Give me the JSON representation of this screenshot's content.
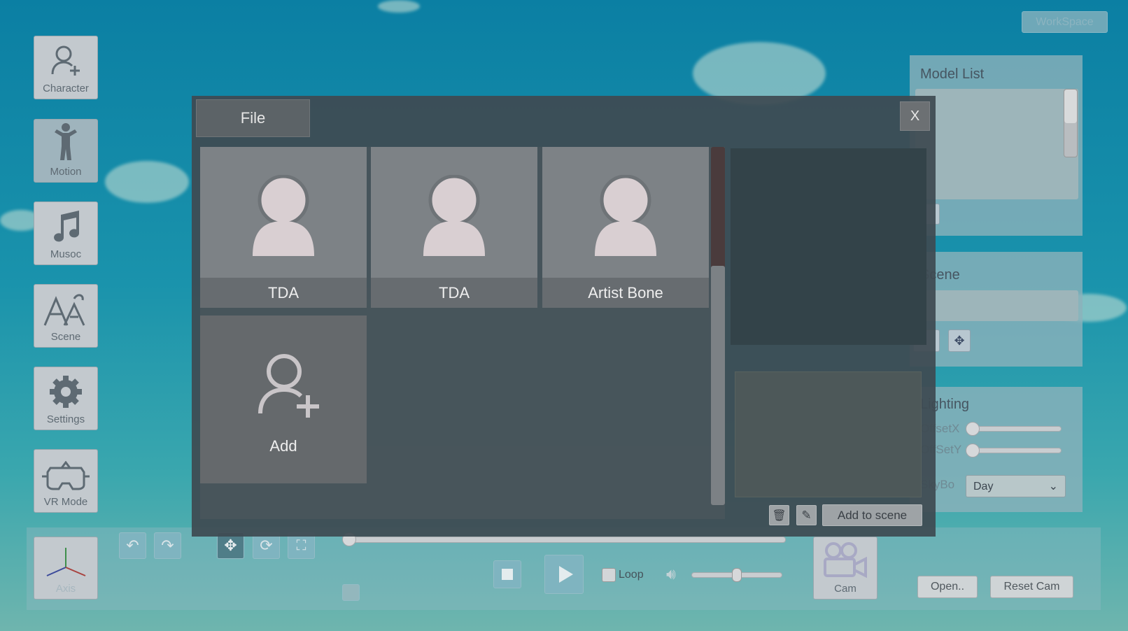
{
  "workspace_button": "WorkSpace",
  "sidebar": {
    "items": [
      {
        "label": "Character",
        "icon": "person-add-icon"
      },
      {
        "label": "Motion",
        "icon": "figure-icon"
      },
      {
        "label": "Musoc",
        "icon": "music-note-icon"
      },
      {
        "label": "Scene",
        "icon": "scene-icon"
      },
      {
        "label": "Settings",
        "icon": "gear-icon"
      },
      {
        "label": "VR Mode",
        "icon": "vr-headset-icon"
      }
    ]
  },
  "dialog": {
    "tab": "File",
    "close": "X",
    "models": [
      {
        "name": "TDA"
      },
      {
        "name": "TDA"
      },
      {
        "name": "Artist Bone"
      }
    ],
    "add_label": "Add",
    "add_to_scene": "Add to scene"
  },
  "right": {
    "model_list_title": "Model List",
    "scene_title": "Scene",
    "lighting_title": "Lighting",
    "offset_x": "OffsetX",
    "offset_y": "OffSetY",
    "skybox_label": "SkyBo",
    "skybox_value": "Day",
    "offset_x_value": 0,
    "offset_y_value": 0
  },
  "bottom": {
    "axis": "Axis",
    "loop": "Loop",
    "cam": "Cam",
    "open": "Open..",
    "reset_cam": "Reset Cam",
    "timeline_progress": 0,
    "volume": 0.5,
    "loop_checked": false
  }
}
